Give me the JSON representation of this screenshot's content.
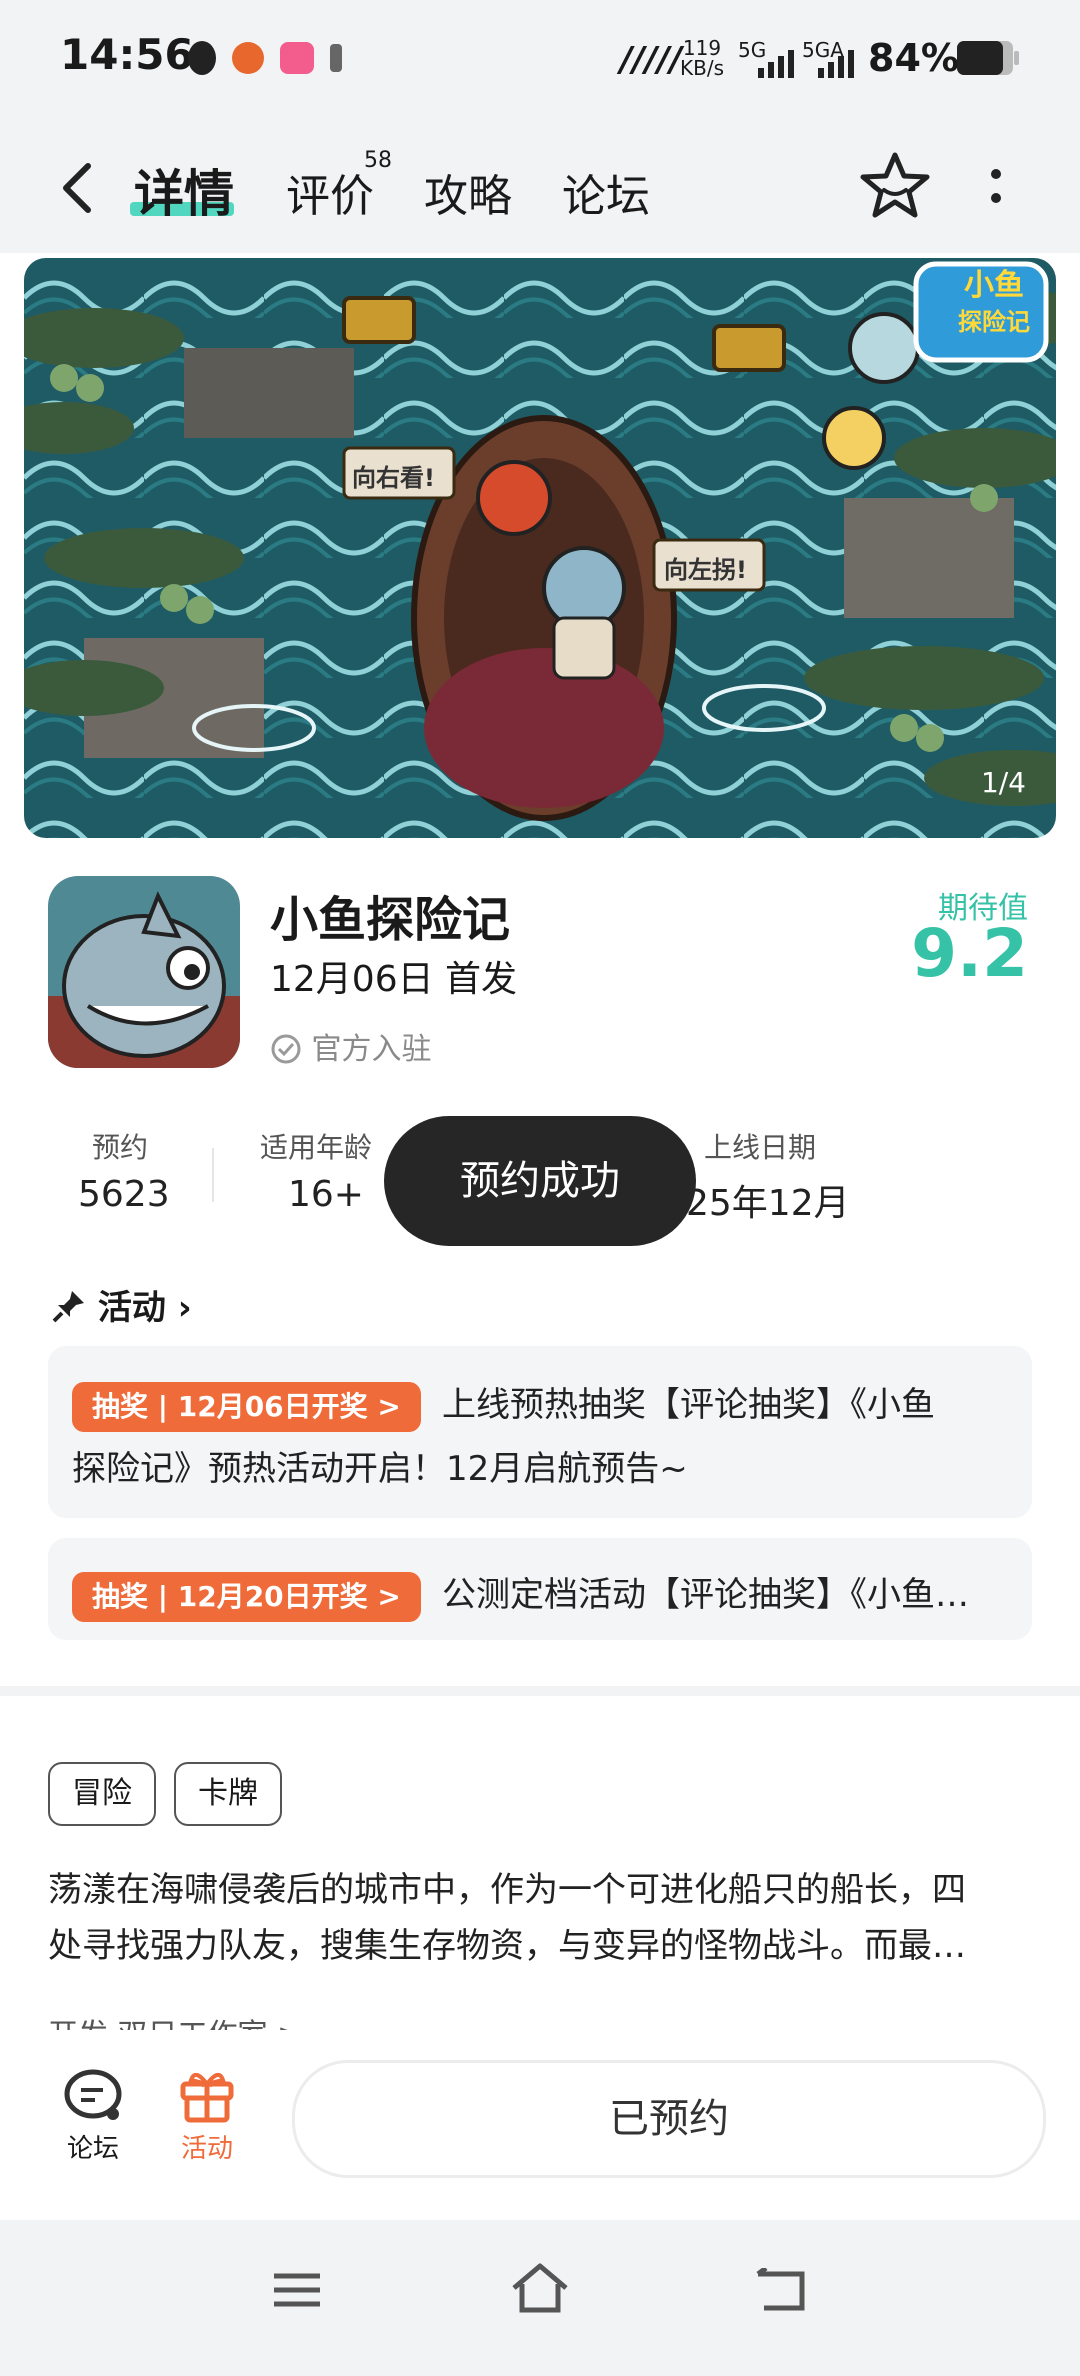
{
  "status": {
    "time": "14:56",
    "speed_value": "119",
    "speed_unit": "KB/s",
    "net1": "5G",
    "net2": "5GA",
    "battery": "84%"
  },
  "nav": {
    "tabs": [
      {
        "label": "详情",
        "active": true
      },
      {
        "label": "评价",
        "badge": "58"
      },
      {
        "label": "攻略"
      },
      {
        "label": "论坛"
      }
    ]
  },
  "banner": {
    "logo_text_line1": "小鱼",
    "logo_text_line2": "探险记",
    "sign_left": "向右看!",
    "sign_right": "向左拐!",
    "counter": "1/4"
  },
  "game": {
    "title": "小鱼探险记",
    "release": "12月06日 首发",
    "official": "官方入驻",
    "expect_label": "期待值",
    "expect_value": "9.2"
  },
  "stats": [
    {
      "label": "预约",
      "value": "5623"
    },
    {
      "label": "适用年龄",
      "value": "16+"
    },
    {
      "label": "上线日期",
      "value": "25年12月"
    }
  ],
  "toast": "预约成功",
  "activity": {
    "title": "活动",
    "items": [
      {
        "tag": "抽奖 | 12月06日开奖 >",
        "text_line1": "上线预热抽奖【评论抽奖】《小鱼",
        "text_line2": "探险记》预热活动开启！12月启航预告~"
      },
      {
        "tag": "抽奖 | 12月20日开奖 >",
        "text_line1": "公测定档活动【评论抽奖】《小鱼…"
      }
    ]
  },
  "tags": [
    "冒险",
    "卡牌"
  ],
  "description": {
    "line1": "荡漾在海啸侵袭后的城市中，作为一个可进化船只的船长，四",
    "line2": "处寻找强力队友，搜集生存物资，与变异的怪物战斗。而最…"
  },
  "developer": "开发  双日工作室 >",
  "actionbar": {
    "forum_label": "论坛",
    "activity_label": "活动",
    "reserved_label": "已预约"
  },
  "colors": {
    "accent_green": "#35c2a6",
    "accent_orange": "#ef6b3a",
    "toast_bg": "#262626"
  }
}
